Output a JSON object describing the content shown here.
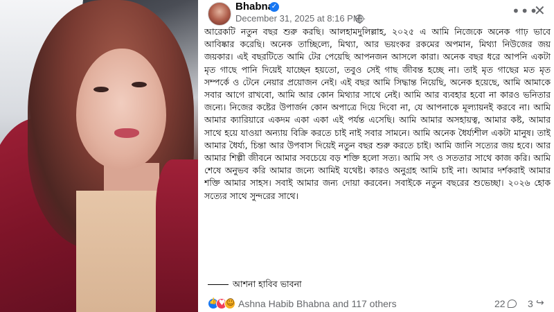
{
  "post": {
    "author": "Bhabna",
    "date": "December 31, 2025 at 8:16 PM",
    "separator": "·",
    "body": "আরেকটি নতুন বছর শুরু করছি। আলহামদুলিল্লাহ, ২০২৫ এ আমি নিজেকে অনেক গাঢ় ভাবে আবিষ্কার করেছি। অনেক তাচ্ছিল্যে, মিথ্যা, আর ভয়ংকর রকমের অপমান, মিথ্যা নিউজের জয় জয়কার। এই বছরটিতে আমি টের পেয়েছি আপনজন আসলে কারা। অনেক বছর ধরে আপনি একটা মৃত গাছে পানি দিয়েই যাচ্ছেন হয়তো, তবুও সেই গাছ জীবন্ত হচ্ছে না। তাই মৃত গাছের মত মৃত সম্পর্কে ও টেনে নেয়ার প্রয়োজন নেই। এই বছর আমি সিদ্ধান্ত নিয়েছি, অনেক হয়েছে, আমি আমাকে সবার আগে রাখবো, আমি আর কোন মিথ্যার সাথে নেই। আমি আর ব্যবহার হবো না কারও ভনিতার জন্যে। নিজের কষ্টের উপার্জন কোন অপাত্রে দিয়ে দিবো না, যে আপনাকে মূল্যায়নই করবে না। আমি আমার ক্যারিয়ারে একদম একা একা এই পর্যন্ত এসেছি। আমি আমার অসহায়ত্ব, আমার কষ্ট, আমার সাথে হয়ে যাওয়া অন্যায় বিক্রি করতে চাই নাই সবার সামনে। আমি অনেক ধৈর্য্যশীল একটা মানুষ। তাই আমার ধৈর্য্য, চিন্তা আর উপবাস দিয়েই নতুন বছর শুরু করতে চাই। আমি জানি সত্যের জয় হবে। আর আমার শিল্পী জীবনে আমার সবচেয়ে বড় শক্তি হলো সত্য। আমি সৎ ও সততার সাথে কাজ করি। আমি শেষে অনুভব করি আমার জন্যে আমিই যথেষ্ট। কারও অনুগ্রহ আমি চাই না। আমার দর্শকরাই আমার শক্তি আমার সাহস। সবাই আমার জন্য দোয়া করবেন। সবাইকে নতুন বছরের শুভেচ্ছা। ২০২৬ হোক সত্যের সাথে সুন্দরের সাথে।",
    "signature": "আশনা হাবিব ভাবনা"
  },
  "reactions": {
    "summary": "Ashna Habib Bhabna and 117 others",
    "comments": "22",
    "shares": "3",
    "icons": [
      "like-icon",
      "love-icon",
      "care-icon"
    ]
  },
  "icons": {
    "verified": "verified-badge-icon",
    "audience": "globe-icon",
    "more": "more-options-icon",
    "close": "close-icon",
    "comment": "comment-icon",
    "share": "share-icon"
  },
  "colors": {
    "verified": "#1877f2",
    "secondary_text": "#65676b",
    "like": "#1877f2",
    "love": "#f33e58",
    "care": "#f7b125"
  }
}
